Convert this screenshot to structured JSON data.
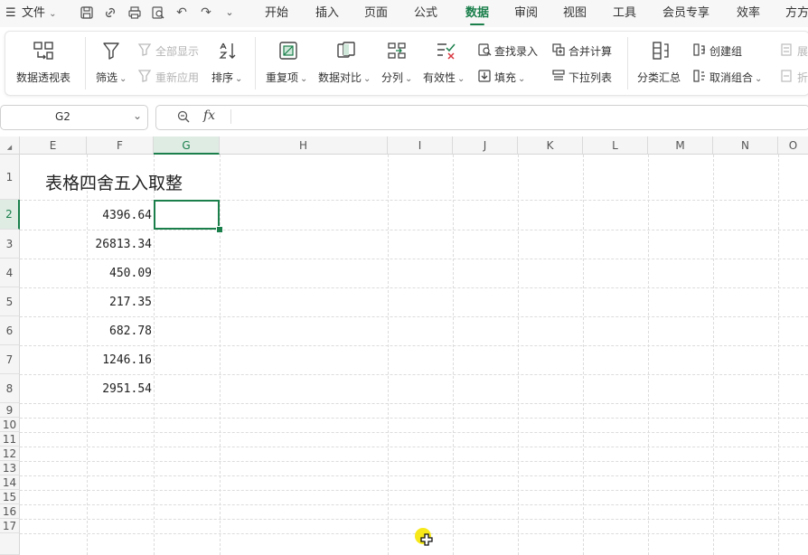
{
  "menubar": {
    "file_label": "文件",
    "tabs": [
      {
        "label": "开始"
      },
      {
        "label": "插入"
      },
      {
        "label": "页面"
      },
      {
        "label": "公式"
      },
      {
        "label": "数据",
        "active": true
      },
      {
        "label": "审阅"
      },
      {
        "label": "视图"
      },
      {
        "label": "工具"
      },
      {
        "label": "会员专享"
      },
      {
        "label": "效率"
      },
      {
        "label": "方方"
      }
    ]
  },
  "ribbon": {
    "pivot": "数据透视表",
    "filter": "筛选",
    "show_all": "全部显示",
    "reapply": "重新应用",
    "sort": "排序",
    "duplicates": "重复项",
    "compare": "数据对比",
    "split": "分列",
    "validity": "有效性",
    "lookup_entry": "查找录入",
    "fill": "填充",
    "consolidate": "合并计算",
    "dropdown_list": "下拉列表",
    "subtotal": "分类汇总",
    "create_group": "创建组",
    "ungroup": "取消组合",
    "expand": "展",
    "collapse": "折"
  },
  "formula_bar": {
    "cell_ref": "G2",
    "fx": "fx",
    "content": ""
  },
  "sheet": {
    "columns": [
      "E",
      "F",
      "G",
      "H",
      "I",
      "J",
      "K",
      "L",
      "M",
      "N",
      "O"
    ],
    "selected_column": "G",
    "rows": [
      "1",
      "2",
      "3",
      "4",
      "5",
      "6",
      "7",
      "8",
      "9",
      "10",
      "11",
      "12",
      "13",
      "14",
      "15",
      "16",
      "17"
    ],
    "selected_row": "2",
    "title": "表格四舍五入取整",
    "values": [
      "4396.64",
      "26813.34",
      "450.09",
      "217.35",
      "682.78",
      "1246.16",
      "2951.54"
    ],
    "selected_cell": "G2"
  },
  "colors": {
    "accent": "#1a7f4b",
    "menubar_bg": "#f7f7f7",
    "header_bg": "#f5f5f5",
    "cursor": "#f5e600"
  }
}
